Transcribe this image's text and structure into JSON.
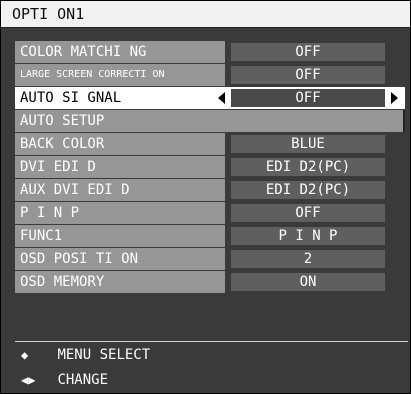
{
  "title": "OPTI ON1",
  "rows": [
    {
      "label": "COLOR MATCHI NG",
      "value": "OFF"
    },
    {
      "label": "LARGE SCREEN CORRECTI ON",
      "value": "OFF"
    },
    {
      "label": "AUTO SI GNAL",
      "value": "OFF"
    },
    {
      "label": "AUTO SETUP"
    },
    {
      "label": "BACK COLOR",
      "value": "BLUE"
    },
    {
      "label": "DVI  EDI D",
      "value": "EDI D2(PC)"
    },
    {
      "label": "AUX DVI  EDI D",
      "value": "EDI D2(PC)"
    },
    {
      "label": "P I N P",
      "value": "OFF"
    },
    {
      "label": "FUNC1",
      "value": "P I N P"
    },
    {
      "label": "OSD POSI TI ON",
      "value": "2"
    },
    {
      "label": "OSD MEMORY",
      "value": "ON"
    }
  ],
  "hints": [
    {
      "icon": "up-down-arrows-icon",
      "glyph": "◆",
      "label": "MENU SELECT"
    },
    {
      "icon": "left-right-arrows-icon",
      "glyph": "◀▶",
      "label": "CHANGE"
    }
  ]
}
